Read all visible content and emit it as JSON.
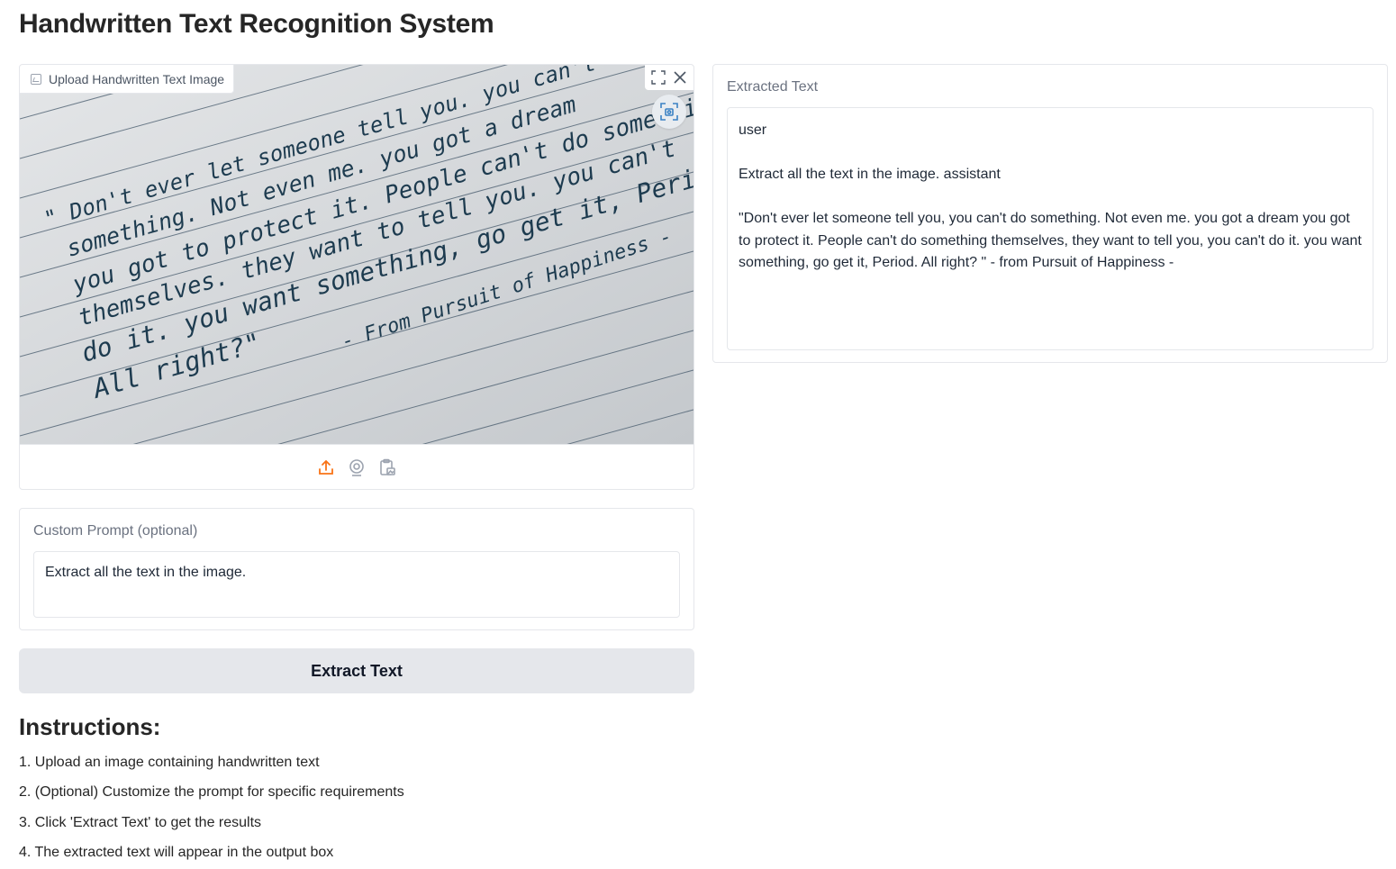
{
  "page": {
    "title": "Handwritten Text Recognition System"
  },
  "upload": {
    "label": "Upload Handwritten Text Image",
    "image_text_lines": [
      "\" Don't ever let someone tell you. you can't do",
      "something. Not even me. you got a dream",
      "you got to protect it. People can't do something",
      "themselves. they want to tell you. you can't",
      "do it. you want something, go get it, Period.",
      "All right?\"",
      "- From Pursuit of Happiness -"
    ],
    "icons": [
      "fullscreen-icon",
      "close-icon",
      "crop-icon",
      "upload-icon",
      "webcam-icon",
      "clipboard-icon"
    ]
  },
  "output": {
    "label": "Extracted Text",
    "value": "user\n\nExtract all the text in the image. assistant\n\n\"Don't ever let someone tell you, you can't do something. Not even me. you got a dream you got to protect it. People can't do something themselves, they want to tell you, you can't do it. you want something, go get it, Period. All right? \" - from Pursuit of Happiness -"
  },
  "prompt": {
    "label": "Custom Prompt (optional)",
    "value": "Extract all the text in the image."
  },
  "actions": {
    "extract_label": "Extract Text"
  },
  "instructions": {
    "title": "Instructions:",
    "items": [
      "1. Upload an image containing handwritten text",
      "2. (Optional) Customize the prompt for specific requirements",
      "3. Click 'Extract Text' to get the results",
      "4. The extracted text will appear in the output box"
    ]
  },
  "colors": {
    "accent": "#f97316",
    "crop_icon": "#3b82c4",
    "ink": "#1d3b4f"
  }
}
